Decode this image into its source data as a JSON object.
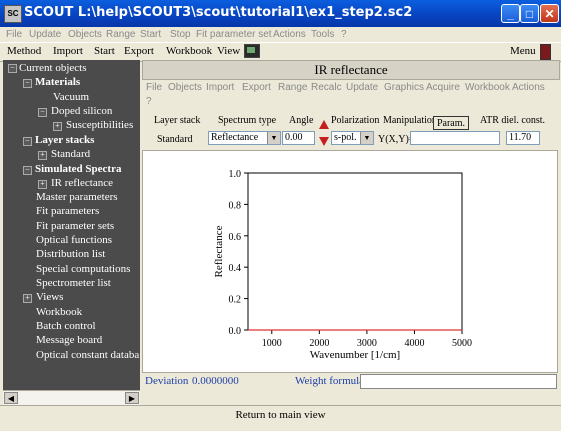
{
  "window": {
    "title": "SCOUT L:\\help\\SCOUT3\\scout\\tutorial1\\ex1_step2.sc2",
    "app_icon_text": "SC"
  },
  "menubar1": [
    "File",
    "Update",
    "Objects",
    "Range",
    "Start",
    "Stop",
    "Fit parameter set",
    "Actions",
    "Tools",
    "?"
  ],
  "menubar2": {
    "items": [
      "Method",
      "Import",
      "Start",
      "Export",
      "Workbook",
      "View"
    ],
    "right": "Menu"
  },
  "tree": {
    "root": "Current objects",
    "materials": "Materials",
    "vacuum": "Vacuum",
    "doped_silicon": "Doped silicon",
    "susceptibilities": "Susceptibilities",
    "layer_stacks": "Layer stacks",
    "standard": "Standard",
    "simulated_spectra": "Simulated Spectra",
    "ir_reflectance": "IR reflectance",
    "master_parameters": "Master parameters",
    "fit_parameters": "Fit parameters",
    "fit_parameter_sets": "Fit parameter sets",
    "optical_functions": "Optical functions",
    "distribution_list": "Distribution list",
    "special_computations": "Special computations",
    "spectrometer_list": "Spectrometer list",
    "views": "Views",
    "workbook": "Workbook",
    "batch_control": "Batch control",
    "message_board": "Message board",
    "optical_constant_database": "Optical constant databa"
  },
  "panel": {
    "title": "IR reflectance",
    "submenu": [
      "File",
      "Objects",
      "Import",
      "Export",
      "Range",
      "Recalc",
      "Update",
      "Graphics",
      "Acquire",
      "Workbook",
      "Actions",
      "?"
    ]
  },
  "controls": {
    "layer_stack_label": "Layer stack",
    "layer_stack_value": "Standard",
    "spectrum_type_label": "Spectrum type",
    "spectrum_type_value": "Reflectance",
    "angle_label": "Angle",
    "angle_value": "0.00",
    "polarization_label": "Polarization",
    "polarization_value": "s-pol.",
    "manipulation_label": "Manipulation",
    "param_button": "Param.",
    "yxy_label": "Y(X,Y)=",
    "yxy_value": "",
    "atr_label": "ATR diel. const.",
    "atr_value": "11.70"
  },
  "chart_data": {
    "type": "line",
    "xlabel": "Wavenumber [1/cm]",
    "ylabel": "Reflectance",
    "xlim": [
      500,
      5000
    ],
    "ylim": [
      0.0,
      1.0
    ],
    "xticks": [
      "1000",
      "2000",
      "3000",
      "4000",
      "5000"
    ],
    "yticks": [
      "0.0",
      "0.2",
      "0.4",
      "0.6",
      "0.8",
      "1.0"
    ],
    "x": [
      500,
      5000
    ],
    "y": [
      0.0,
      0.0
    ],
    "color": "#e03030"
  },
  "status": {
    "deviation_label": "Deviation",
    "deviation_value": "0.0000000",
    "weight_formula_label": "Weight formula:",
    "weight_formula_value": ""
  },
  "bottom": {
    "return_button": "Return to main view"
  }
}
